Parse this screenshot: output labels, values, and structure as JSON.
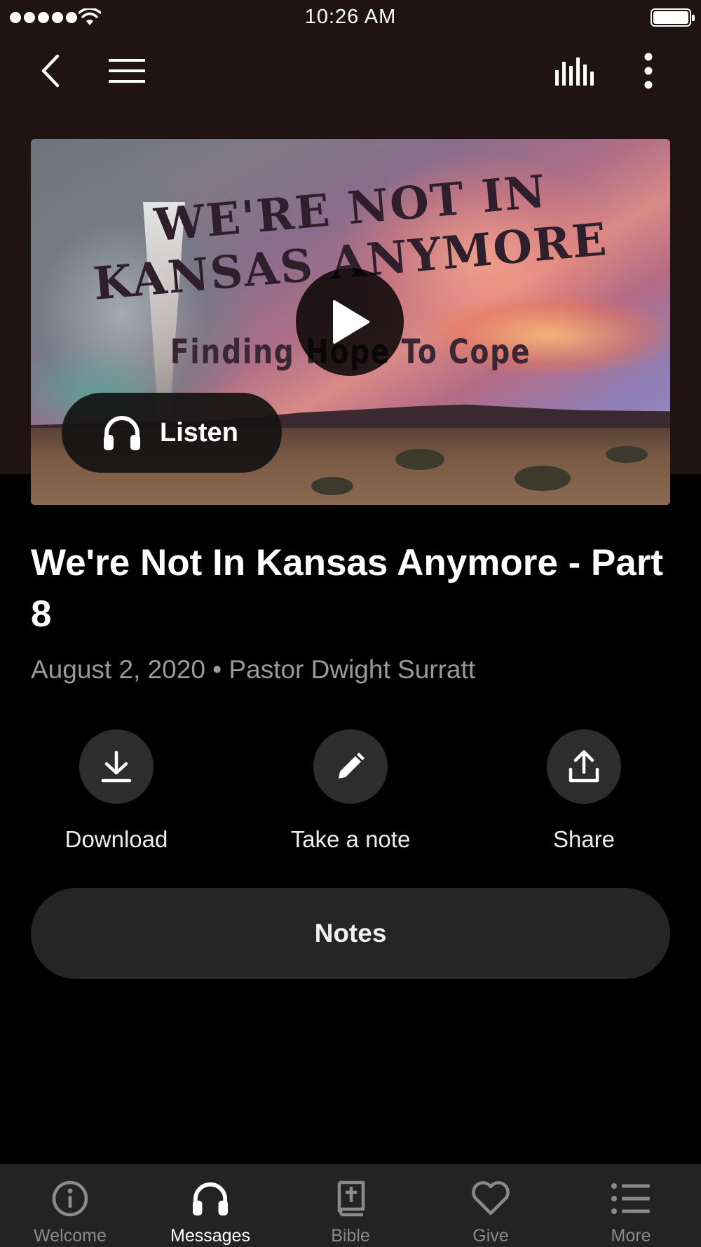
{
  "status_bar": {
    "time": "10:26 AM"
  },
  "nav": {
    "back_icon": "chevron-left-icon",
    "menu_icon": "hamburger-icon",
    "audio_icon": "audio-bars-icon",
    "more_icon": "more-vertical-icon"
  },
  "hero": {
    "artwork_line1": "WE'RE NOT IN",
    "artwork_line2": "KANSAS ANYMORE",
    "artwork_line3": "Finding Hope To Cope",
    "play_icon": "play-icon",
    "listen_label": "Listen"
  },
  "message": {
    "title": "We're Not In Kansas Anymore - Part 8",
    "meta": "August 2, 2020 • Pastor Dwight Surratt"
  },
  "actions": {
    "download_label": "Download",
    "note_label": "Take a note",
    "share_label": "Share"
  },
  "notes_button": {
    "label": "Notes"
  },
  "tabbar": {
    "active": "Messages",
    "tabs": [
      {
        "label": "Welcome",
        "icon": "info-icon"
      },
      {
        "label": "Messages",
        "icon": "headphones-icon"
      },
      {
        "label": "Bible",
        "icon": "bible-icon"
      },
      {
        "label": "Give",
        "icon": "heart-icon"
      },
      {
        "label": "More",
        "icon": "list-icon"
      }
    ]
  },
  "colors": {
    "header_bg": "#1f1314",
    "page_bg": "#000000",
    "button_bg": "#2d2d2d",
    "tabbar_bg": "#232323",
    "inactive_tab": "#8a8a8a"
  }
}
